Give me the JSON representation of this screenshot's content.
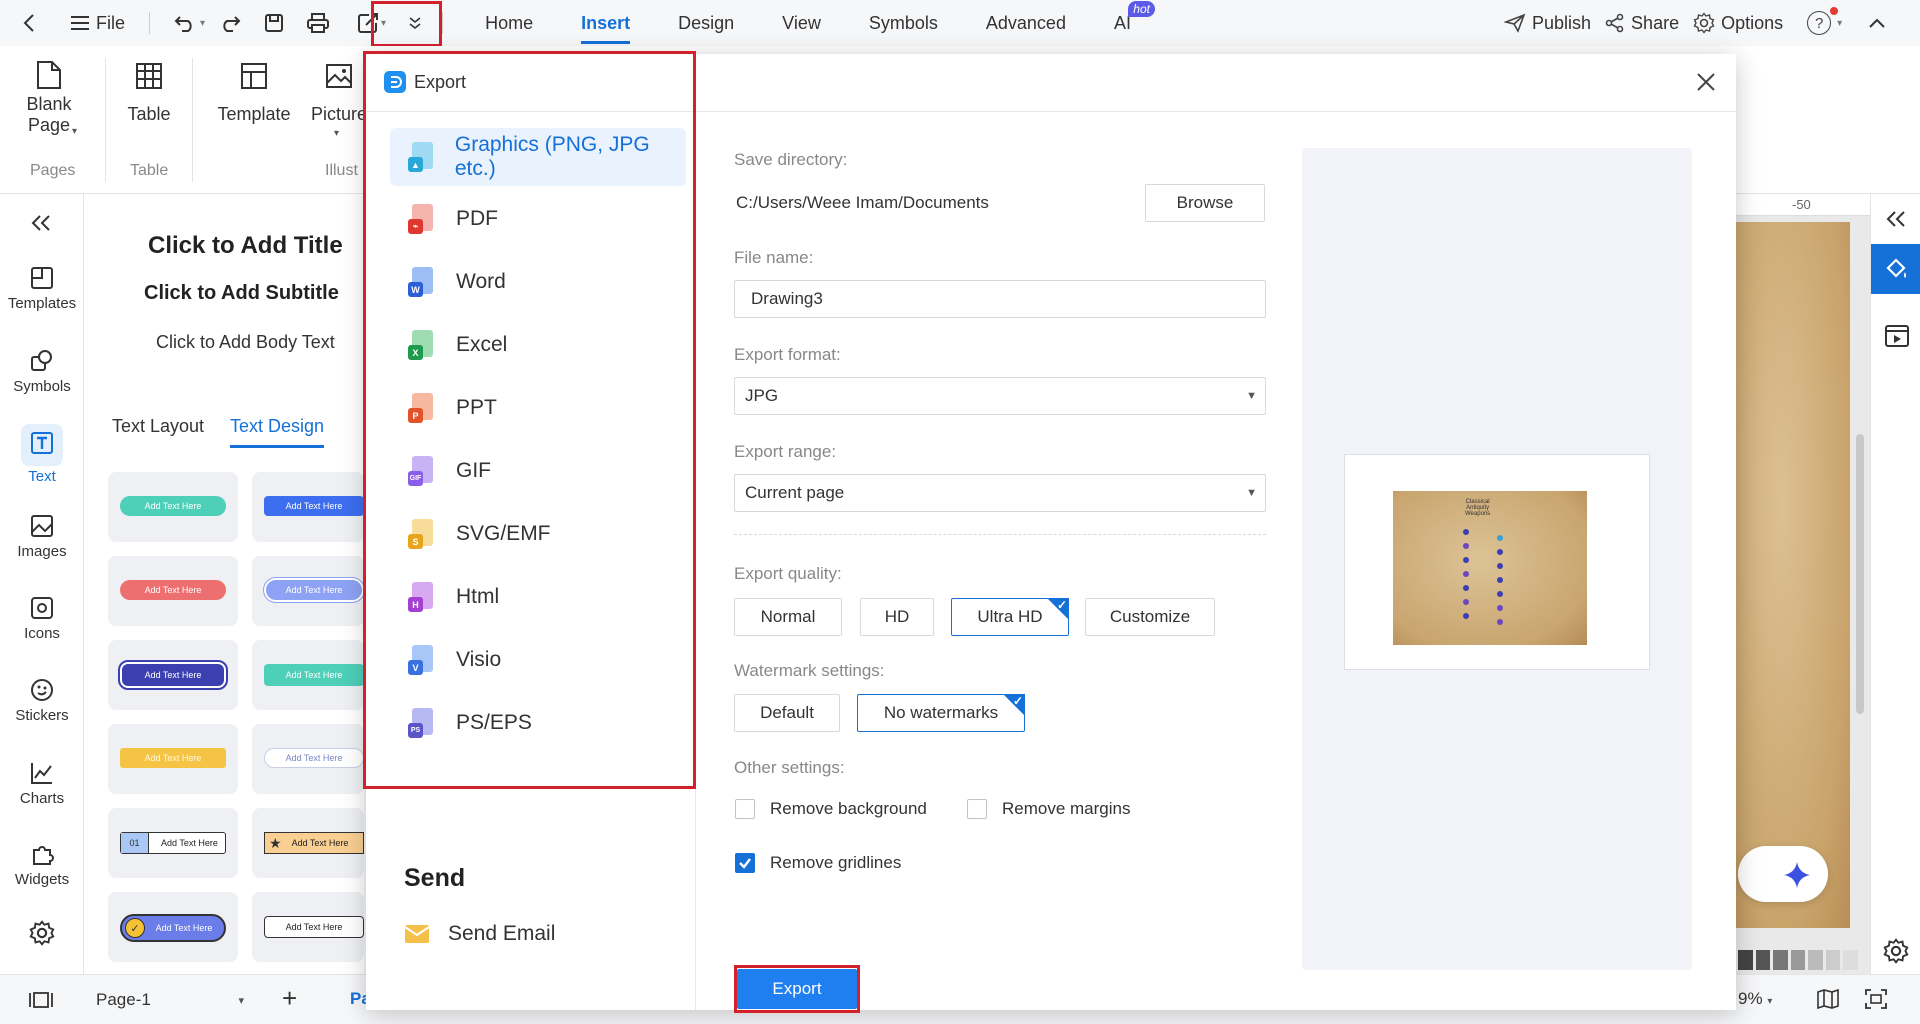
{
  "menubar": {
    "file": "File",
    "tabs": [
      "Home",
      "Insert",
      "Design",
      "View",
      "Symbols",
      "Advanced",
      "AI"
    ],
    "active_tab": "Insert",
    "hot_badge": "hot",
    "publish": "Publish",
    "share": "Share",
    "options": "Options"
  },
  "ribbon": {
    "blank_page": [
      "Blank",
      "Page"
    ],
    "table": "Table",
    "template": "Template",
    "picture": "Picture",
    "groups": {
      "pages": "Pages",
      "table": "Table",
      "illus": "Illust"
    }
  },
  "left_rail": {
    "items": [
      "Templates",
      "Symbols",
      "Text",
      "Images",
      "Icons",
      "Stickers",
      "Charts",
      "Widgets"
    ],
    "active": "Text"
  },
  "left_panel": {
    "title": "Click to Add Title",
    "subtitle": "Click to Add Subtitle",
    "body": "Click to Add Body Text",
    "tabs": [
      "Text Layout",
      "Text Design"
    ],
    "active_tab": "Text Design",
    "design_sample": "Add Text Here",
    "badge_num": "01"
  },
  "dialog": {
    "title": "Export",
    "formats": [
      "Graphics (PNG, JPG etc.)",
      "PDF",
      "Word",
      "Excel",
      "PPT",
      "GIF",
      "SVG/EMF",
      "Html",
      "Visio",
      "PS/EPS"
    ],
    "selected_format": "Graphics (PNG, JPG etc.)",
    "send_heading": "Send",
    "send_email": "Send Email",
    "save_directory_label": "Save directory:",
    "save_directory": "C:/Users/Weee Imam/Documents",
    "browse": "Browse",
    "file_name_label": "File name:",
    "file_name": "Drawing3",
    "export_format_label": "Export format:",
    "export_format": "JPG",
    "export_range_label": "Export range:",
    "export_range": "Current page",
    "export_quality_label": "Export quality:",
    "quality_options": [
      "Normal",
      "HD",
      "Ultra HD",
      "Customize"
    ],
    "quality_selected": "Ultra HD",
    "watermark_label": "Watermark settings:",
    "watermark_options": [
      "Default",
      "No watermarks"
    ],
    "watermark_selected": "No watermarks",
    "other_label": "Other settings:",
    "remove_background": "Remove background",
    "remove_background_checked": false,
    "remove_margins": "Remove margins",
    "remove_margins_checked": false,
    "remove_gridlines": "Remove gridlines",
    "remove_gridlines_checked": true,
    "export_button": "Export"
  },
  "preview": {
    "poster_title": [
      "Classical",
      "Antiquity",
      "Weapons"
    ]
  },
  "canvas": {
    "ruler_label": "-50"
  },
  "statusbar": {
    "page_select": "Page-1",
    "page_tab": "Pa",
    "zoom": "9%"
  },
  "colors": {
    "accent": "#1570d8",
    "highlight": "#d3212c",
    "selected_bg": "#e9f2fd"
  }
}
